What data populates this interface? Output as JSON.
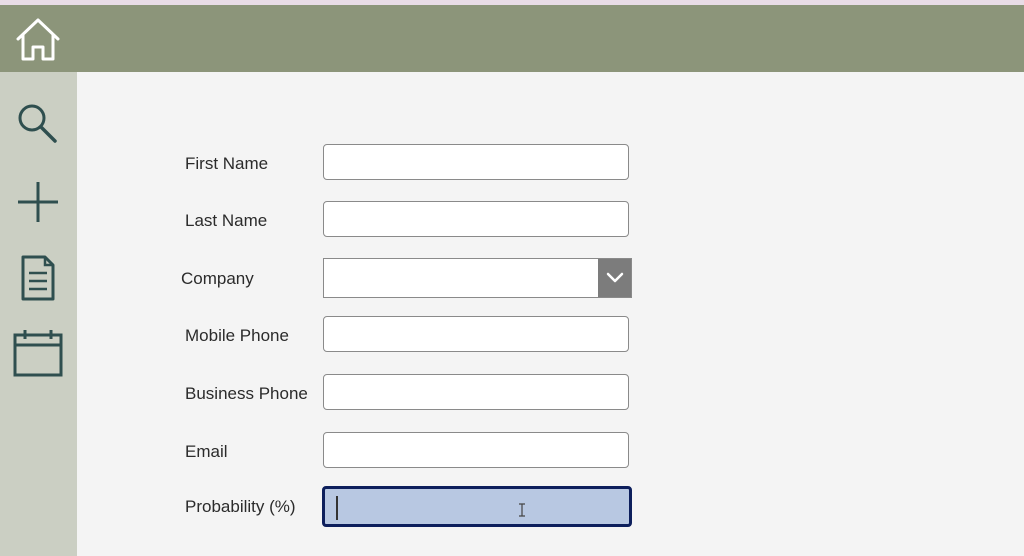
{
  "header": {
    "home_icon": "home-icon",
    "color": "#8c957a"
  },
  "sidebar": {
    "color": "#cbcfc3",
    "items": [
      {
        "name": "search",
        "icon": "search-icon"
      },
      {
        "name": "add",
        "icon": "plus-icon"
      },
      {
        "name": "document",
        "icon": "document-icon"
      },
      {
        "name": "calendar",
        "icon": "calendar-icon"
      }
    ]
  },
  "form": {
    "first_name": {
      "label": "First Name",
      "value": ""
    },
    "last_name": {
      "label": "Last Name",
      "value": ""
    },
    "company": {
      "label": "Company",
      "value": ""
    },
    "mobile_phone": {
      "label": "Mobile Phone",
      "value": ""
    },
    "business_phone": {
      "label": "Business Phone",
      "value": ""
    },
    "email": {
      "label": "Email",
      "value": ""
    },
    "probability": {
      "label": "Probability (%)",
      "value": ""
    }
  }
}
